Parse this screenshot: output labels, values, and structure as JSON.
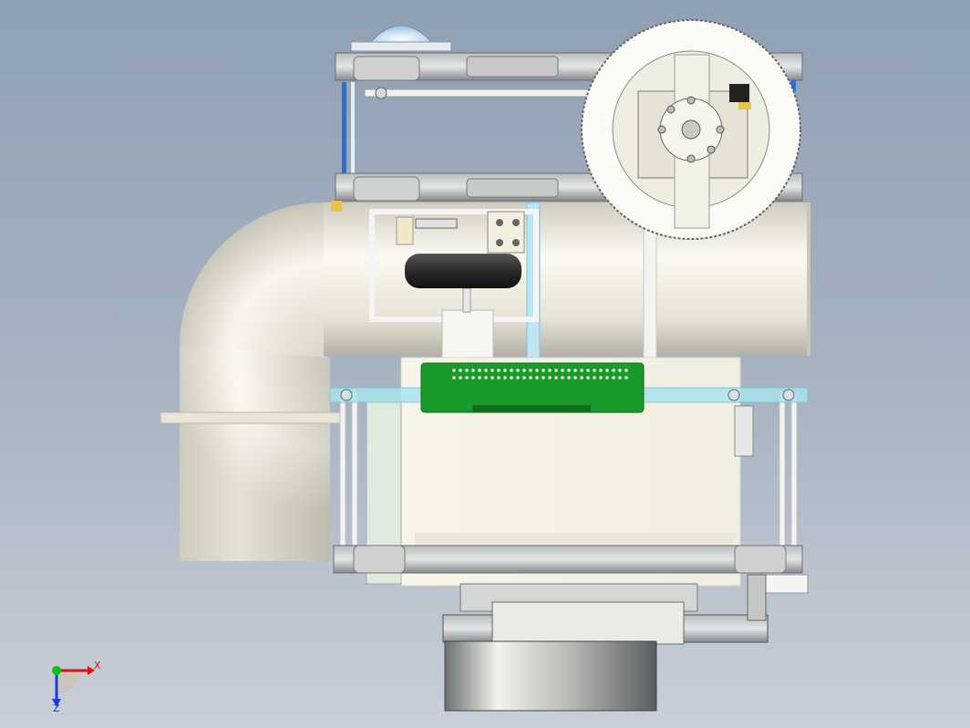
{
  "viewport": {
    "background_top": "#8fa0b4",
    "background_bottom": "#c9cfd8"
  },
  "triad": {
    "x_label": "X",
    "z_label": "Z",
    "x_color": "#e01010",
    "y_color": "#10c010",
    "z_color": "#1a3fd0"
  },
  "model": {
    "parts": [
      "elbow-pipe",
      "wheel",
      "circuit-board",
      "top-plate",
      "middle-plate",
      "bottom-plate",
      "main-housing",
      "base-motor",
      "acrylic-shelf",
      "dome-light"
    ],
    "colors": {
      "pipe": "#e8e6da",
      "metal": "#8f9396",
      "board": "#1a9a2a",
      "acrylic": "#a9e4ec",
      "blue_rod": "#2a6fd0"
    }
  }
}
